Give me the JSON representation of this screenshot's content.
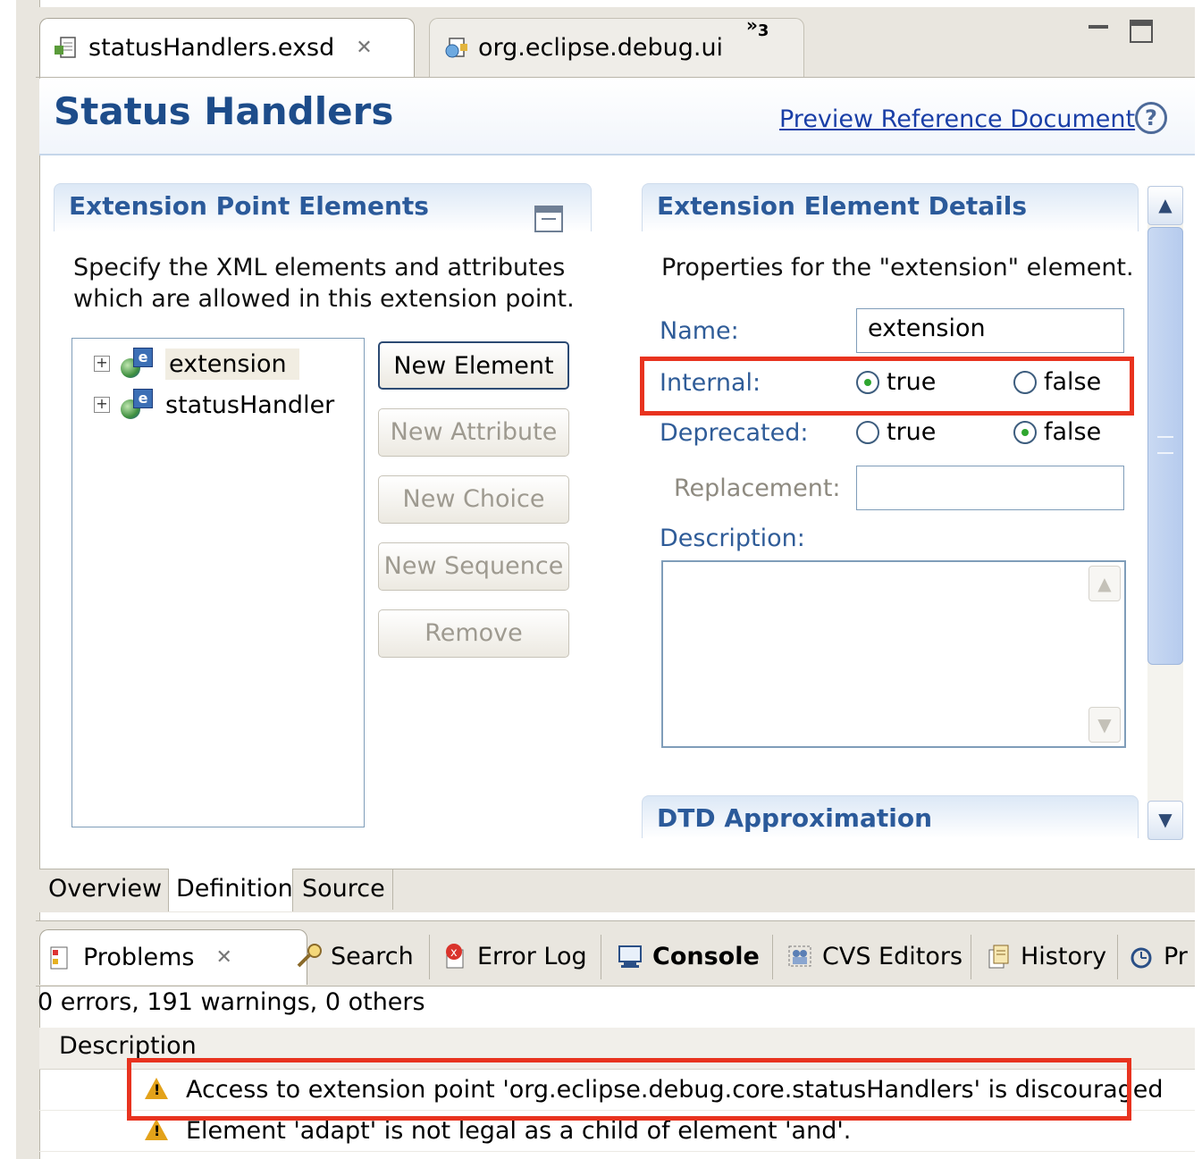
{
  "editor_tabs": [
    {
      "label": "statusHandlers.exsd"
    },
    {
      "label": "org.eclipse.debug.ui"
    }
  ],
  "overflow_count": "3",
  "header": {
    "title": "Status Handlers",
    "preview_link": "Preview Reference Document",
    "help_symbol": "?"
  },
  "elements_section": {
    "title": "Extension Point Elements",
    "description_line1": "Specify the XML elements and attributes",
    "description_line2": "which are allowed in this extension point.",
    "tree": [
      {
        "label": "extension",
        "selected": true
      },
      {
        "label": "statusHandler",
        "selected": false
      }
    ],
    "buttons": {
      "new_element": "New Element",
      "new_attribute": "New Attribute",
      "new_choice": "New Choice",
      "new_sequence": "New Sequence",
      "remove": "Remove"
    }
  },
  "details_section": {
    "title": "Extension Element Details",
    "description": "Properties for the \"extension\" element.",
    "name_label": "Name:",
    "name_value": "extension",
    "internal_label": "Internal:",
    "internal_value": "true",
    "deprecated_label": "Deprecated:",
    "deprecated_value": "false",
    "true_label": "true",
    "false_label": "false",
    "replacement_label": "Replacement:",
    "replacement_value": "",
    "description_label": "Description:",
    "description_value": ""
  },
  "dtd_section": {
    "title": "DTD Approximation"
  },
  "page_tabs": {
    "overview": "Overview",
    "definition": "Definition",
    "source": "Source"
  },
  "view_tabs": {
    "problems": "Problems",
    "search": "Search",
    "error_log": "Error Log",
    "console": "Console",
    "cvs_editors": "CVS Editors",
    "history": "History",
    "truncated": "Pr"
  },
  "problems": {
    "summary": "0 errors, 191 warnings, 0 others",
    "column_description": "Description",
    "rows": [
      {
        "text": "Access to extension point 'org.eclipse.debug.core.statusHandlers' is discouraged"
      },
      {
        "text": "Element 'adapt' is not legal as a child of element 'and'."
      }
    ]
  },
  "colors": {
    "title_blue": "#1d4c8a",
    "section_blue": "#2b5a9a",
    "highlight_red": "#e8331f",
    "link_blue": "#1a3fa7"
  },
  "icons": [
    "file-icon",
    "plugin-icon",
    "close-icon",
    "chevron-overflow-icon",
    "minimize-icon",
    "maximize-icon",
    "help-icon",
    "collapse-icon",
    "expand-icon",
    "element-icon",
    "scroll-up-icon",
    "scroll-down-icon",
    "problems-icon",
    "search-icon",
    "error-log-icon",
    "console-icon",
    "cvs-icon",
    "history-icon",
    "progress-icon",
    "warning-icon"
  ]
}
